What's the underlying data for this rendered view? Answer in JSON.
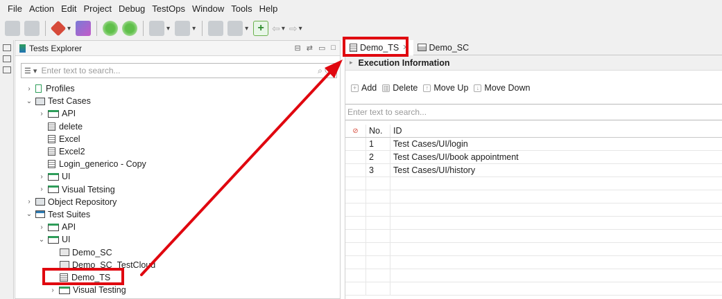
{
  "menu": [
    "File",
    "Action",
    "Edit",
    "Project",
    "Debug",
    "TestOps",
    "Window",
    "Tools",
    "Help"
  ],
  "explorer": {
    "title": "Tests Explorer",
    "search_placeholder": "Enter text to search...",
    "tree": [
      {
        "label": "Profiles",
        "icon": "profile-icon",
        "expanded": false
      },
      {
        "label": "Test Cases",
        "icon": "test-cases-folder-icon",
        "expanded": true
      },
      {
        "label": "API",
        "icon": "folder-icon",
        "expanded": false
      },
      {
        "label": "delete",
        "icon": "test-case-icon"
      },
      {
        "label": "Excel",
        "icon": "test-case-icon"
      },
      {
        "label": "Excel2",
        "icon": "test-case-icon"
      },
      {
        "label": "Login_generico - Copy",
        "icon": "test-case-icon"
      },
      {
        "label": "UI",
        "icon": "folder-icon",
        "expanded": false
      },
      {
        "label": "Visual Tetsing",
        "icon": "folder-icon",
        "expanded": false
      },
      {
        "label": "Object Repository",
        "icon": "object-repository-icon",
        "expanded": false
      },
      {
        "label": "Test Suites",
        "icon": "test-suites-folder-icon",
        "expanded": true
      },
      {
        "label": "API",
        "icon": "folder-icon",
        "expanded": false
      },
      {
        "label": "UI",
        "icon": "folder-icon",
        "expanded": true
      },
      {
        "label": "Demo_SC",
        "icon": "test-suite-collection-icon"
      },
      {
        "label": "Demo_SC_TestCloud",
        "icon": "test-suite-collection-icon"
      },
      {
        "label": "Demo_TS",
        "icon": "test-suite-icon"
      },
      {
        "label": "Visual Testing",
        "icon": "folder-icon",
        "expanded": false
      }
    ]
  },
  "editor": {
    "tabs": [
      {
        "label": "Demo_TS",
        "active": true
      },
      {
        "label": "Demo_SC",
        "active": false
      }
    ],
    "section_title": "Execution Information",
    "actions": {
      "add": "Add",
      "delete": "Delete",
      "move_up": "Move Up",
      "move_down": "Move Down"
    },
    "search_placeholder": "Enter text to search...",
    "columns": {
      "no": "No.",
      "id": "ID"
    },
    "rows": [
      {
        "no": "1",
        "id": "Test Cases/UI/login"
      },
      {
        "no": "2",
        "id": "Test Cases/UI/book appointment"
      },
      {
        "no": "3",
        "id": "Test Cases/UI/history"
      }
    ]
  },
  "annotation_color": "#e0070f"
}
